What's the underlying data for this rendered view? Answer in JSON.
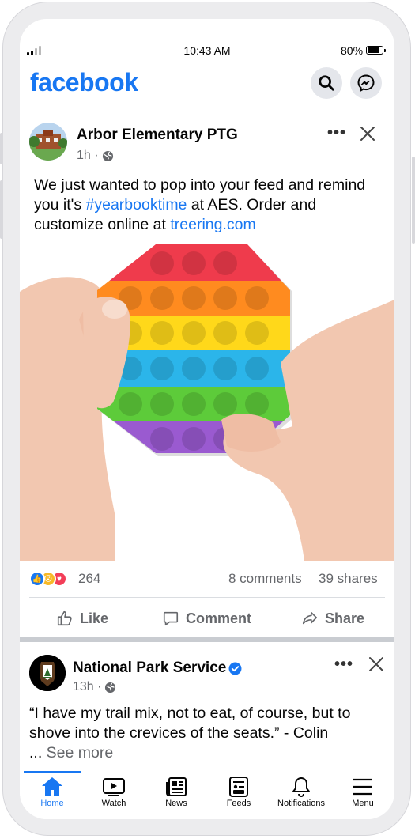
{
  "status": {
    "time": "10:43 AM",
    "battery": "80%"
  },
  "header": {
    "logo": "facebook",
    "search_icon": "search-icon",
    "messenger_icon": "messenger-icon"
  },
  "post1": {
    "author": "Arbor Elementary PTG",
    "time": "1h ·",
    "text_before": "We just wanted to pop into your feed and remind you it's ",
    "hashtag": "#yearbooktime",
    "text_middle": " at AES. Order and customize online at ",
    "link": "treering.com",
    "reaction_count": "264",
    "comments": "8 comments",
    "shares": "39 shares",
    "actions": {
      "like": "Like",
      "comment": "Comment",
      "share": "Share"
    }
  },
  "post2": {
    "author": "National Park Service",
    "time": "13h ·",
    "text": "“I have my trail mix, not to eat, of course, but to shove into the crevices of the seats.” - Colin",
    "ellipsis": "... ",
    "see_more": "See more"
  },
  "nav": [
    {
      "label": "Home",
      "icon": "home-icon"
    },
    {
      "label": "Watch",
      "icon": "watch-icon"
    },
    {
      "label": "News",
      "icon": "news-icon"
    },
    {
      "label": "Feeds",
      "icon": "feeds-icon"
    },
    {
      "label": "Notifications",
      "icon": "bell-icon"
    },
    {
      "label": "Menu",
      "icon": "menu-icon"
    }
  ],
  "colors": {
    "brand": "#1877f2",
    "text": "#050505",
    "secondary": "#65676b"
  }
}
